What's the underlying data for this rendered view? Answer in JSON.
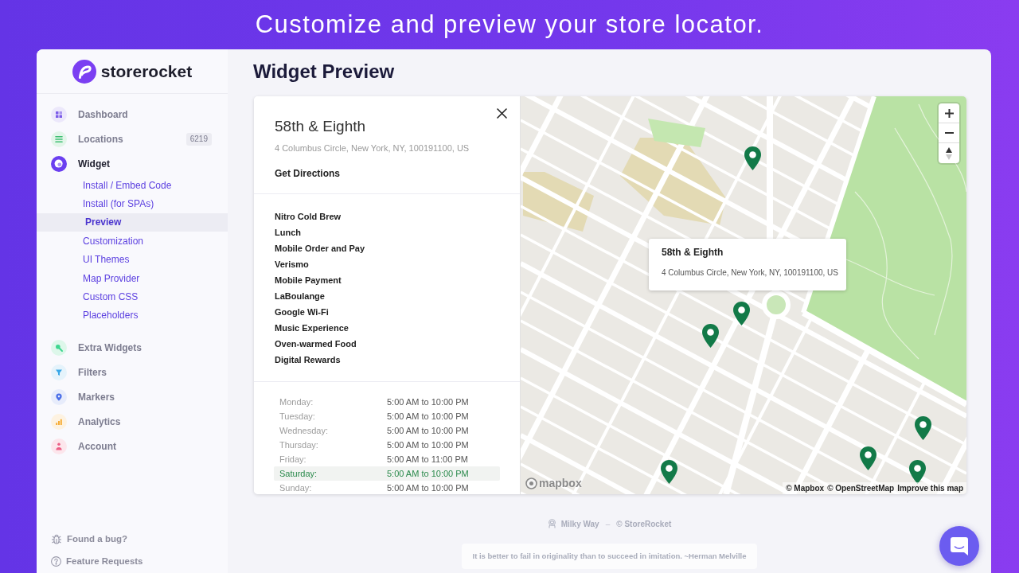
{
  "banner": {
    "title": "Customize and preview your store locator."
  },
  "sidebar": {
    "logo": "storerocket",
    "items": [
      {
        "label": "Dashboard",
        "selected": false
      },
      {
        "label": "Locations",
        "selected": false,
        "badge": "6219"
      },
      {
        "label": "Widget",
        "selected": true,
        "children": [
          {
            "label": "Install / Embed Code",
            "selected": false
          },
          {
            "label": "Install (for SPAs)",
            "selected": false
          },
          {
            "label": "Preview",
            "selected": true
          },
          {
            "label": "Customization",
            "selected": false
          },
          {
            "label": "UI Themes",
            "selected": false
          },
          {
            "label": "Map Provider",
            "selected": false
          },
          {
            "label": "Custom CSS",
            "selected": false
          },
          {
            "label": "Placeholders",
            "selected": false
          }
        ]
      },
      {
        "label": "Extra Widgets",
        "selected": false
      },
      {
        "label": "Filters",
        "selected": false
      },
      {
        "label": "Markers",
        "selected": false
      },
      {
        "label": "Analytics",
        "selected": false
      },
      {
        "label": "Account",
        "selected": false
      }
    ],
    "footer_links": [
      "Found a bug?",
      "Feature Requests"
    ]
  },
  "main": {
    "title": "Widget Preview",
    "store": {
      "name": "58th & Eighth",
      "address": "4 Columbus Circle, New York, NY, 100191100, US",
      "directions": "Get Directions",
      "features": [
        "Nitro Cold Brew",
        "Lunch",
        "Mobile Order and Pay",
        "Verismo",
        "Mobile Payment",
        "LaBoulange",
        "Google Wi-Fi",
        "Music Experience",
        "Oven-warmed Food",
        "Digital Rewards"
      ],
      "hours": [
        {
          "day": "Monday:",
          "time": "5:00 AM to 10:00 PM",
          "selected": false
        },
        {
          "day": "Tuesday:",
          "time": "5:00 AM to 10:00 PM",
          "selected": false
        },
        {
          "day": "Wednesday:",
          "time": "5:00 AM to 10:00 PM",
          "selected": false
        },
        {
          "day": "Thursday:",
          "time": "5:00 AM to 10:00 PM",
          "selected": false
        },
        {
          "day": "Friday:",
          "time": "5:00 AM to 11:00 PM",
          "selected": false
        },
        {
          "day": "Saturday:",
          "time": "5:00 AM to 10:00 PM",
          "selected": true
        },
        {
          "day": "Sunday:",
          "time": "5:00 AM to 10:00 PM",
          "selected": false
        }
      ]
    },
    "map": {
      "popup": {
        "name": "58th & Eighth",
        "address": "4 Columbus Circle, New York, NY, 100191100, US"
      },
      "logo": "mapbox",
      "attribution": [
        "© Mapbox",
        "© OpenStreetMap",
        "Improve this map"
      ]
    },
    "footer": {
      "site": "Milky Way",
      "separator": "–",
      "copyright": "© StoreRocket",
      "quote": "It is better to fail in originality than to succeed in imitation. ~Herman Melville"
    }
  }
}
